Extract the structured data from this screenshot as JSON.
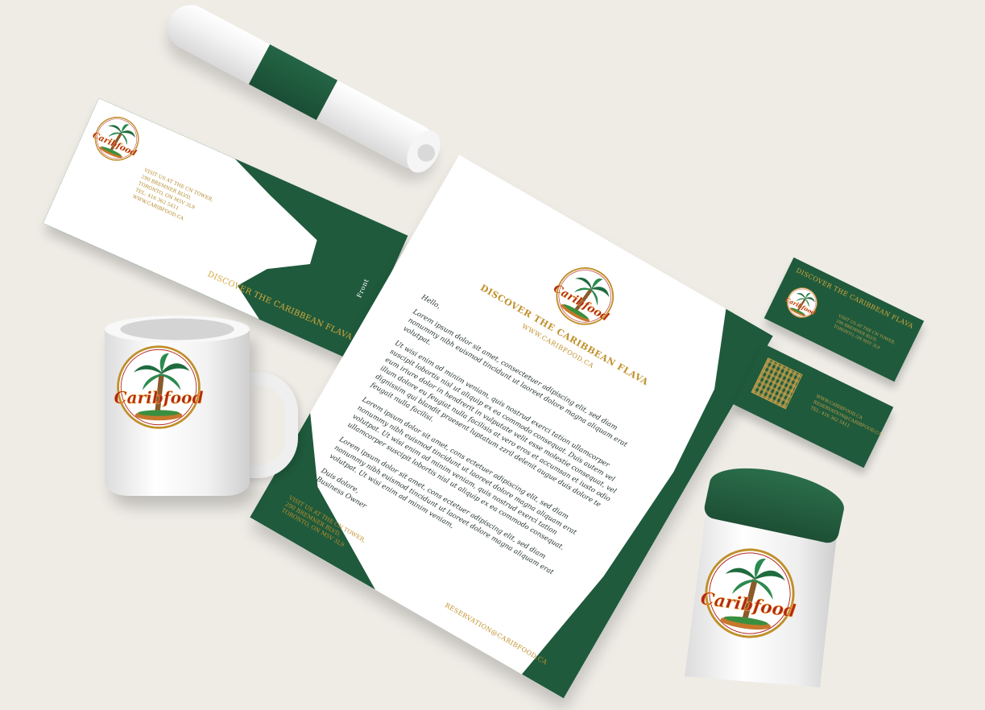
{
  "brand": {
    "logo_text": "Caribfood",
    "tagline": "DISCOVER THE CARIBBEAN FLAVA",
    "website": "WWW.CARIBFOOD.CA",
    "reservation_email": "RESERVATION@CARIBFOOD.CA",
    "colors": {
      "green": "#1f5a3c",
      "gold": "#c0902a",
      "red": "#b3261e",
      "background": "#efece6"
    }
  },
  "envelope": {
    "front_label": "Front",
    "tagline": "DISCOVER THE CARIBBEAN FLAVA",
    "address_lines": [
      "VISIT US AT THE CN TOWER,",
      "290 BREMNER BLVD,",
      "TORONTO, ON M5V 3L9",
      "TEL: 416 362 5411",
      "WWW.CARIBFOOD.CA"
    ]
  },
  "letterhead": {
    "tagline": "DISCOVER THE CARIBBEAN FLAVA",
    "website": "WWW.CARIBFOOD.CA",
    "greeting": "Hello,",
    "paragraphs": [
      "Lorem ipsum dolor sit amet, consectetuer adipiscing elit, sed diam nonummy nibh euismod tincidunt ut laoreet dolore magna aliquam erat volutpat.",
      "Ut wisi enim ad minim veniam, quis nostrud exerci tation ullamcorper suscipit lobortis nisl ut aliquip ex ea commodo consequat. Duis autem vel eum iriure dolor in hendrerit in vulputate velit esse molestie consequat, vel illum dolore eu feugiat nulla facilisis at vero eros et accumsan et iusto odio dignissim qui blandit praesent luptatum zzril delenit augue duis dolore te feugait nulla facilisi.",
      "Lorem ipsum dolor sit amet, cons ectetuer adipiscing elit, sed diam nonummy nibh euismod tincidunt ut laoreet dolore magna aliquam erat volutpat. Ut wisi enim ad minim veniam, quis nostrud exerci tation ullamcorper suscipit lobortis nisl ut aliquip ex ea commodo consequat.",
      "Lorem ipsum dolor sit amet, cons ectetuer adipiscing elit, sed diam nonummy nibh euismod tincidunt ut laoreet dolore magna aliquam erat volutpat. Ut wisi enim ad minim veniam,"
    ],
    "closing": "Duis dolore,",
    "signature": "Business Owner",
    "address_lines": [
      "VISIT US AT THE CN TOWER,",
      "290 BREMNER BLVD,",
      "TORONTO, ON M5V 3L9"
    ],
    "reservation": "RESERVATION@CARIBFOOD.CA"
  },
  "business_card_front": {
    "tagline": "DISCOVER THE CARIBBEAN FLAVA",
    "address_lines": [
      "VISIT US AT THE CN TOWER,",
      "290 BREMNER BLVD,",
      "TORONTO, ON M5V 3L9"
    ]
  },
  "business_card_back": {
    "info_lines": [
      "WWW.CARIBFOOD.CA",
      "RESERVATION@CARIBFOOD.CA",
      "TEL: 416 362 5411"
    ]
  },
  "icons": {
    "logo": "palm-tree-logo-icon",
    "qr": "qr-code-icon"
  }
}
